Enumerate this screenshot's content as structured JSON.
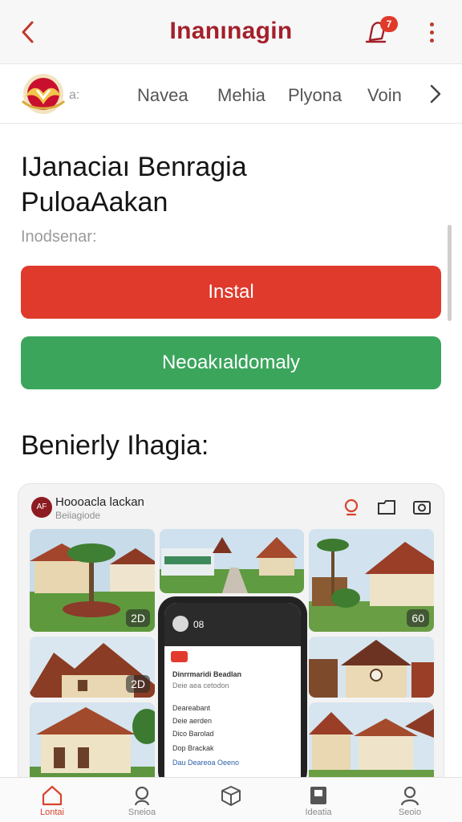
{
  "appbar": {
    "title": "Inanınagin",
    "badge_count": "7",
    "icons": [
      "chevron-left-icon",
      "bell-icon",
      "more-vertical-icon"
    ]
  },
  "navstrip": {
    "logo_text": "a:",
    "items": [
      "Navea",
      "Mehia",
      "Plyona",
      "Voin"
    ]
  },
  "content": {
    "heading_line1": "IJanaciaı Benragia",
    "heading_line2": "PuloaAakan",
    "subtext": "Inodsenar:",
    "install_label": "Instal",
    "secondary_label": "Neoakıaldomaly",
    "section_title": "Benierly Ihagia:"
  },
  "card": {
    "avatar_text": "AF",
    "name": "Hoooacla lackan",
    "subtitle": "Beiiagiode",
    "tile_counts": [
      "2D",
      "2D",
      "60"
    ],
    "phone": {
      "status": "08",
      "list_title": "Dinrrmaridi Beadlan",
      "list_sub": "Deie aea cetodon",
      "rows": [
        "Deareabant",
        "Deie aerden",
        "Dico Barolad",
        "Dop Brackak",
        "Dau Deareoa Oeeno"
      ]
    }
  },
  "bottomnav": {
    "tabs": [
      {
        "label": "Lontai",
        "icon": "home-icon",
        "active": true
      },
      {
        "label": "Sneioa",
        "icon": "search-icon",
        "active": false
      },
      {
        "label": "",
        "icon": "box-icon",
        "active": false
      },
      {
        "label": "Ideatia",
        "icon": "bookmark-icon",
        "active": false
      },
      {
        "label": "Seoio",
        "icon": "user-icon",
        "active": false
      }
    ]
  },
  "colors": {
    "brand": "#a3202a",
    "primary_button": "#df3a2c",
    "secondary_button": "#3ba55c",
    "active_tab": "#d9432f"
  }
}
